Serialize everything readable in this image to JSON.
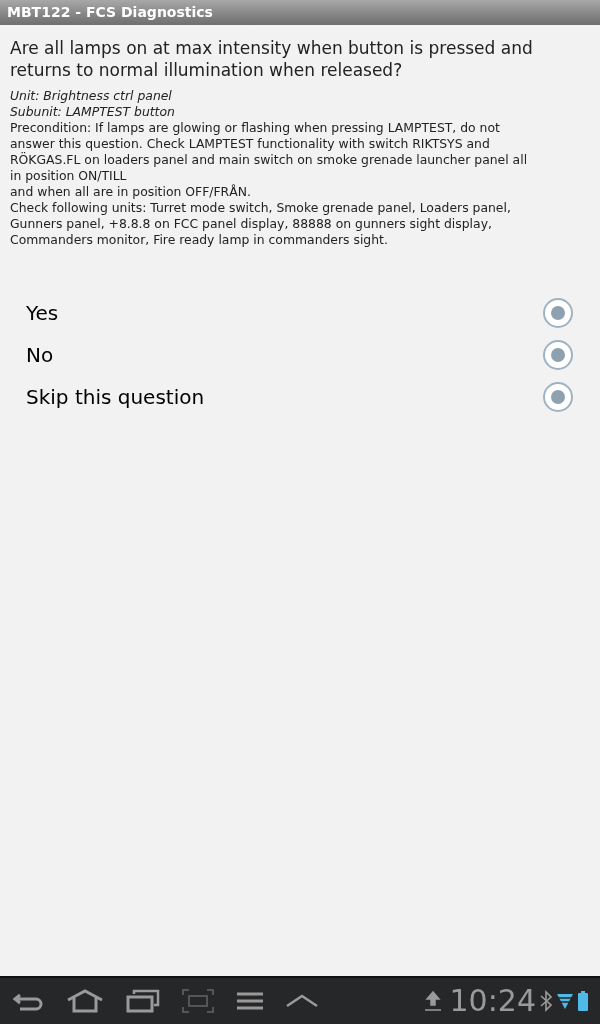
{
  "window": {
    "title": "MBT122 - FCS Diagnostics"
  },
  "question": "Are all lamps on at max intensity when button is pressed and returns to normal illumination when released?",
  "details": [
    {
      "kind": "italic",
      "text": "Unit: Brightness ctrl panel"
    },
    {
      "kind": "italic",
      "text": "Subunit: LAMPTEST button"
    },
    {
      "kind": "plain",
      "text": "Precondition: If lamps are glowing or flashing when pressing LAMPTEST, do not answer this question. Check LAMPTEST functionality with switch RIKTSYS and RÖKGAS.FL on loaders panel and main switch on smoke grenade launcher panel all in position ON/TILL"
    },
    {
      "kind": "plain",
      "text": "and when all are in position OFF/FRÅN."
    },
    {
      "kind": "plain",
      "text": "Check following units: Turret mode switch, Smoke grenade panel, Loaders panel, Gunners panel, +8.8.8 on FCC panel display, 88888 on gunners sight display, Commanders monitor, Fire ready lamp in commanders sight."
    }
  ],
  "options": [
    {
      "label": "Yes",
      "selected": true
    },
    {
      "label": "No",
      "selected": true
    },
    {
      "label": "Skip this question",
      "selected": true
    }
  ],
  "status_bar": {
    "time": "10:24"
  }
}
